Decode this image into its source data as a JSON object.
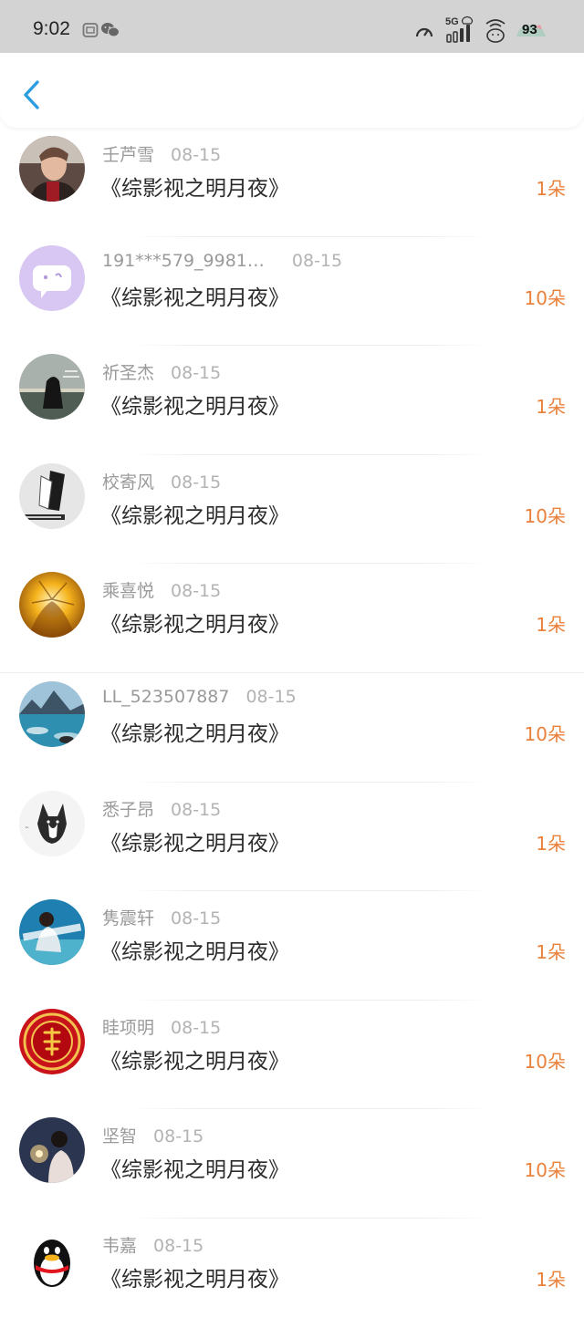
{
  "status_bar": {
    "time": "9:02",
    "network": "5G",
    "battery": "93"
  },
  "header": {
    "back_icon": "chevron-left-icon",
    "accent": "#2a9ee0"
  },
  "colors": {
    "amount": "#e9813b",
    "name": "#9a9a9a",
    "title": "#2b2b2b"
  },
  "rows": [
    {
      "name": "壬芦雪",
      "date": "08-15",
      "title": "《综影视之明月夜》",
      "amount": "1朵"
    },
    {
      "name": "191***579_9981…",
      "date": "08-15",
      "title": "《综影视之明月夜》",
      "amount": "10朵"
    },
    {
      "name": "祈圣杰",
      "date": "08-15",
      "title": "《综影视之明月夜》",
      "amount": "1朵"
    },
    {
      "name": "校寄风",
      "date": "08-15",
      "title": "《综影视之明月夜》",
      "amount": "10朵"
    },
    {
      "name": "乘喜悦",
      "date": "08-15",
      "title": "《综影视之明月夜》",
      "amount": "1朵"
    },
    {
      "name": "LL_523507887",
      "date": "08-15",
      "title": "《综影视之明月夜》",
      "amount": "10朵"
    },
    {
      "name": "悉子昂",
      "date": "08-15",
      "title": "《综影视之明月夜》",
      "amount": "1朵"
    },
    {
      "name": "隽震轩",
      "date": "08-15",
      "title": "《综影视之明月夜》",
      "amount": "1朵"
    },
    {
      "name": "眭项明",
      "date": "08-15",
      "title": "《综影视之明月夜》",
      "amount": "10朵"
    },
    {
      "name": "坚智",
      "date": "08-15",
      "title": "《综影视之明月夜》",
      "amount": "10朵"
    },
    {
      "name": "韦嘉",
      "date": "08-15",
      "title": "《综影视之明月夜》",
      "amount": "1朵"
    }
  ]
}
